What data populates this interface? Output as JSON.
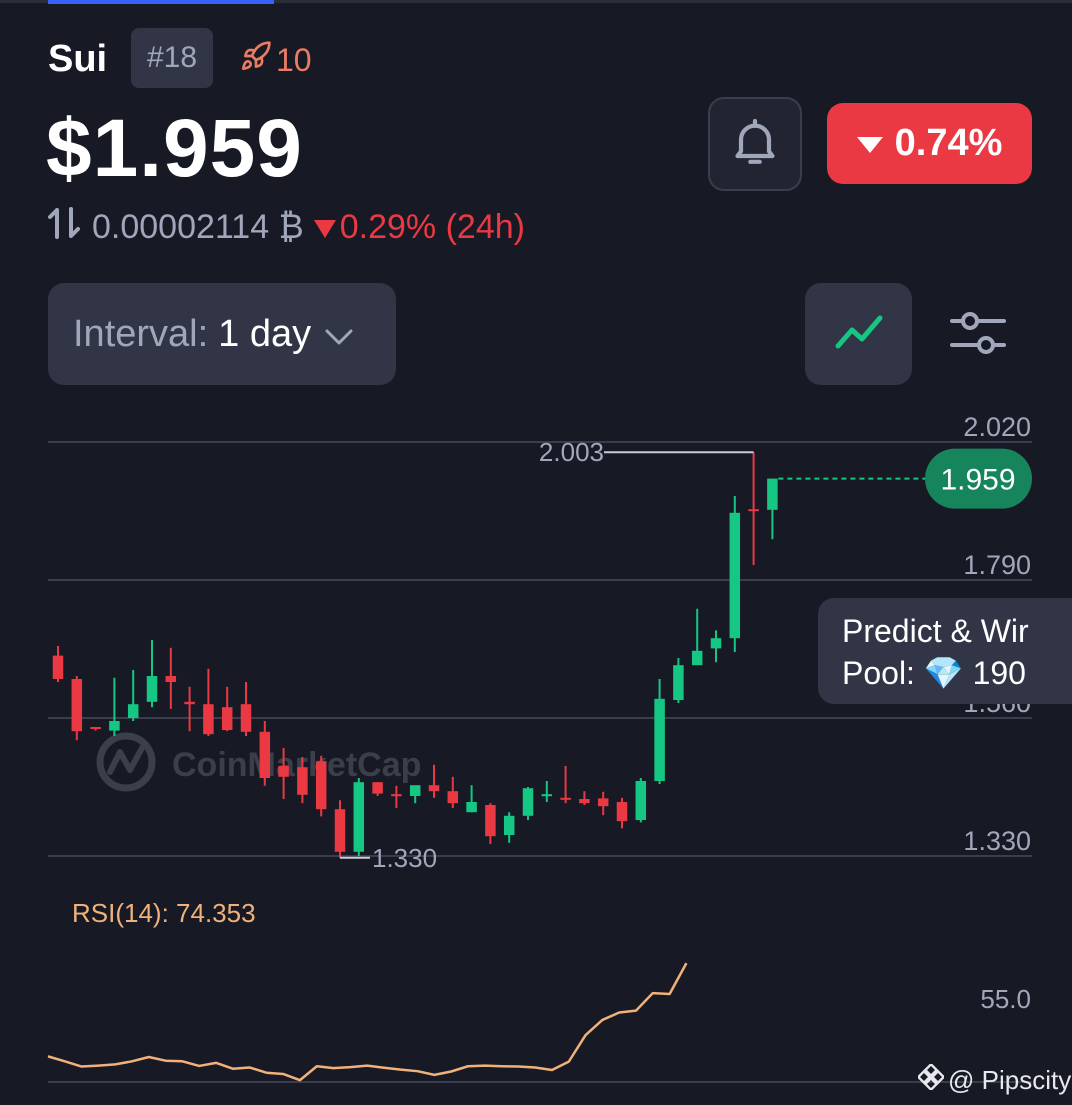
{
  "header": {
    "coin_name": "Sui",
    "rank": "#18",
    "watchlist_count": "10",
    "price": "$1.959",
    "change_24h": "0.74%",
    "btc_price": "0.00002114 ₿",
    "btc_change": "0.29% (24h)"
  },
  "controls": {
    "interval_label": "Interval:",
    "interval_value": "1 day"
  },
  "colors": {
    "up": "#16c784",
    "down": "#ea3943",
    "rsi": "#f0b27a",
    "background": "#171924",
    "panel": "#323546"
  },
  "icons": [
    "arrows-exchange-icon",
    "rocket-icon",
    "bell-icon",
    "triangle-down-icon",
    "chevron-down-icon",
    "line-chart-icon",
    "sliders-icon",
    "diamond-icon",
    "binance-icon"
  ],
  "predict_popup": {
    "line1": "Predict & Wir",
    "line2": "Pool: 💎 190"
  },
  "watermark": {
    "chart_logo": "CoinMarketCap",
    "credit": "@ Pipscity"
  },
  "chart_data": [
    {
      "type": "candlestick",
      "ylim": [
        1.26,
        2.06
      ],
      "y_ticks": [
        "2.020",
        "1.790",
        "1.560",
        "1.330"
      ],
      "current_price_label": "1.959",
      "high_label": "2.003",
      "low_label": "1.330",
      "grid": true,
      "candles": [
        {
          "o": 1.664,
          "h": 1.68,
          "l": 1.62,
          "c": 1.625
        },
        {
          "o": 1.625,
          "h": 1.63,
          "l": 1.523,
          "c": 1.538
        },
        {
          "o": 1.545,
          "h": 1.545,
          "l": 1.539,
          "c": 1.543
        },
        {
          "o": 1.539,
          "h": 1.627,
          "l": 1.53,
          "c": 1.555
        },
        {
          "o": 1.56,
          "h": 1.64,
          "l": 1.555,
          "c": 1.583
        },
        {
          "o": 1.587,
          "h": 1.69,
          "l": 1.578,
          "c": 1.63
        },
        {
          "o": 1.63,
          "h": 1.677,
          "l": 1.575,
          "c": 1.62
        },
        {
          "o": 1.587,
          "h": 1.612,
          "l": 1.538,
          "c": 1.583
        },
        {
          "o": 1.583,
          "h": 1.642,
          "l": 1.53,
          "c": 1.533
        },
        {
          "o": 1.578,
          "h": 1.612,
          "l": 1.538,
          "c": 1.54
        },
        {
          "o": 1.583,
          "h": 1.62,
          "l": 1.53,
          "c": 1.537
        },
        {
          "o": 1.537,
          "h": 1.555,
          "l": 1.447,
          "c": 1.46
        },
        {
          "o": 1.48,
          "h": 1.51,
          "l": 1.425,
          "c": 1.462
        },
        {
          "o": 1.478,
          "h": 1.495,
          "l": 1.418,
          "c": 1.432
        },
        {
          "o": 1.488,
          "h": 1.497,
          "l": 1.396,
          "c": 1.408
        },
        {
          "o": 1.408,
          "h": 1.423,
          "l": 1.327,
          "c": 1.337
        },
        {
          "o": 1.337,
          "h": 1.46,
          "l": 1.33,
          "c": 1.453
        },
        {
          "o": 1.453,
          "h": 1.453,
          "l": 1.43,
          "c": 1.434
        },
        {
          "o": 1.433,
          "h": 1.447,
          "l": 1.41,
          "c": 1.43
        },
        {
          "o": 1.43,
          "h": 1.447,
          "l": 1.418,
          "c": 1.448
        },
        {
          "o": 1.448,
          "h": 1.482,
          "l": 1.427,
          "c": 1.438
        },
        {
          "o": 1.438,
          "h": 1.462,
          "l": 1.41,
          "c": 1.418
        },
        {
          "o": 1.403,
          "h": 1.448,
          "l": 1.403,
          "c": 1.42
        },
        {
          "o": 1.415,
          "h": 1.418,
          "l": 1.35,
          "c": 1.363
        },
        {
          "o": 1.365,
          "h": 1.403,
          "l": 1.352,
          "c": 1.397
        },
        {
          "o": 1.397,
          "h": 1.445,
          "l": 1.39,
          "c": 1.443
        },
        {
          "o": 1.433,
          "h": 1.455,
          "l": 1.42,
          "c": 1.433
        },
        {
          "o": 1.427,
          "h": 1.48,
          "l": 1.418,
          "c": 1.425
        },
        {
          "o": 1.425,
          "h": 1.438,
          "l": 1.415,
          "c": 1.418
        },
        {
          "o": 1.426,
          "h": 1.437,
          "l": 1.398,
          "c": 1.413
        },
        {
          "o": 1.42,
          "h": 1.427,
          "l": 1.376,
          "c": 1.388
        },
        {
          "o": 1.39,
          "h": 1.46,
          "l": 1.386,
          "c": 1.455
        },
        {
          "o": 1.455,
          "h": 1.625,
          "l": 1.45,
          "c": 1.592
        },
        {
          "o": 1.59,
          "h": 1.66,
          "l": 1.585,
          "c": 1.648
        },
        {
          "o": 1.648,
          "h": 1.742,
          "l": 1.65,
          "c": 1.672
        },
        {
          "o": 1.676,
          "h": 1.706,
          "l": 1.653,
          "c": 1.693
        },
        {
          "o": 1.693,
          "h": 1.93,
          "l": 1.67,
          "c": 1.902
        },
        {
          "o": 1.908,
          "h": 2.003,
          "l": 1.815,
          "c": 1.907
        },
        {
          "o": 1.907,
          "h": 1.958,
          "l": 1.858,
          "c": 1.959
        }
      ]
    },
    {
      "type": "line",
      "title": "RSI(14): 74.353",
      "y_ticks": [
        "55.0"
      ],
      "ylim": [
        33.5,
        75
      ],
      "values": [
        41.8,
        40.2,
        38.5,
        38.8,
        39.2,
        40.2,
        41.6,
        40.4,
        40.2,
        38.7,
        39.7,
        37.8,
        38.2,
        36.5,
        36.1,
        34.1,
        38.6,
        38.0,
        38.3,
        38.8,
        38.1,
        37.5,
        37.0,
        35.8,
        36.9,
        38.6,
        38.8,
        38.6,
        38.5,
        38.2,
        37.4,
        40.1,
        48.7,
        53.6,
        56.0,
        56.6,
        62.3,
        62.0,
        72.0
      ]
    }
  ]
}
